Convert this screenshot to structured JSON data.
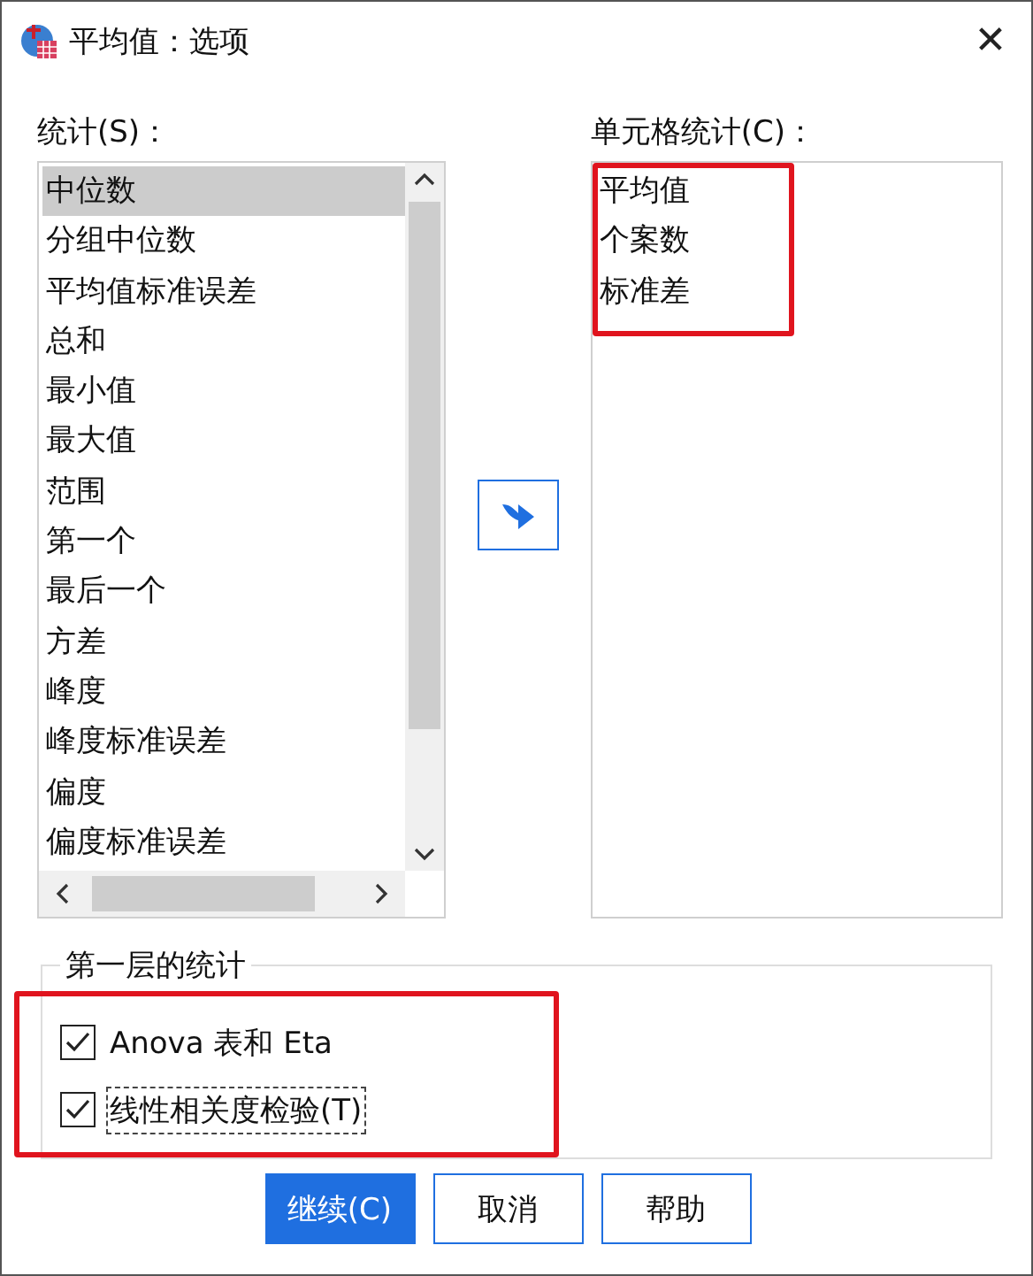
{
  "window": {
    "title": "平均值：选项",
    "close": "✕"
  },
  "statistics": {
    "label": "统计(S)：",
    "items": [
      {
        "label": "中位数",
        "selected": true
      },
      {
        "label": "分组中位数",
        "selected": false
      },
      {
        "label": "平均值标准误差",
        "selected": false
      },
      {
        "label": "总和",
        "selected": false
      },
      {
        "label": "最小值",
        "selected": false
      },
      {
        "label": "最大值",
        "selected": false
      },
      {
        "label": "范围",
        "selected": false
      },
      {
        "label": "第一个",
        "selected": false
      },
      {
        "label": "最后一个",
        "selected": false
      },
      {
        "label": "方差",
        "selected": false
      },
      {
        "label": "峰度",
        "selected": false
      },
      {
        "label": "峰度标准误差",
        "selected": false
      },
      {
        "label": "偏度",
        "selected": false
      },
      {
        "label": "偏度标准误差",
        "selected": false
      }
    ]
  },
  "cell_statistics": {
    "label": "单元格统计(C)：",
    "items": [
      {
        "label": "平均值",
        "selected": false
      },
      {
        "label": "个案数",
        "selected": false
      },
      {
        "label": "标准差",
        "selected": false
      }
    ]
  },
  "first_layer": {
    "legend": "第一层的统计",
    "options": [
      {
        "label": "Anova 表和 Eta",
        "checked": true,
        "focused": false
      },
      {
        "label": "线性相关度检验(T)",
        "checked": true,
        "focused": true
      }
    ]
  },
  "buttons": [
    {
      "label": "继续(C)",
      "primary": true
    },
    {
      "label": "取消",
      "primary": false
    },
    {
      "label": "帮助",
      "primary": false
    }
  ]
}
